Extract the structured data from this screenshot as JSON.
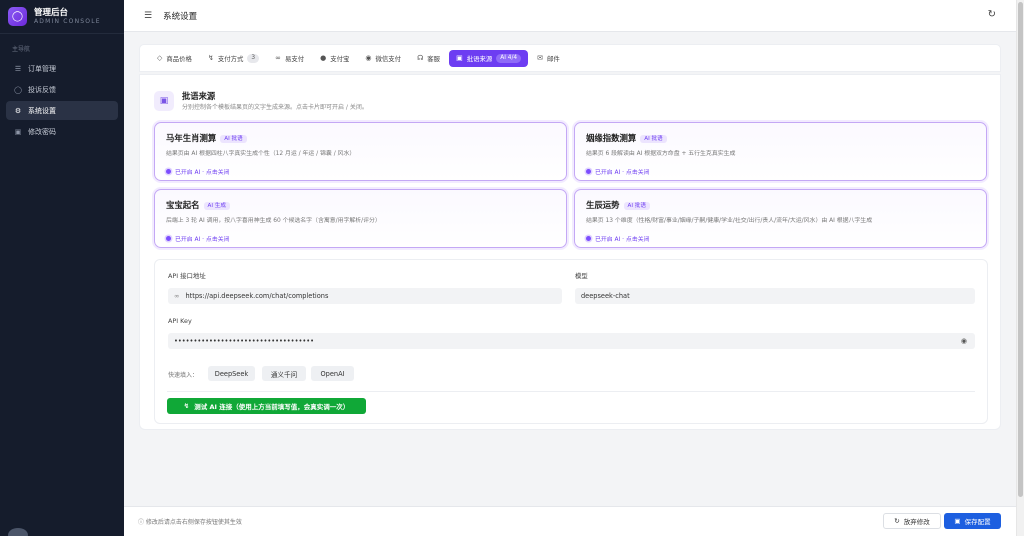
{
  "app": {
    "title": "管理后台",
    "subtitle": "ADMIN CONSOLE",
    "logo_icon": "lightbulb-icon"
  },
  "sidebar": {
    "section": "主导航",
    "items": [
      {
        "label": "订单管理",
        "icon": "list-icon",
        "active": false
      },
      {
        "label": "投诉反馈",
        "icon": "chat-bubble-icon",
        "active": false
      },
      {
        "label": "系统设置",
        "icon": "gear-icon",
        "active": true
      },
      {
        "label": "修改密码",
        "icon": "lock-icon",
        "active": false
      }
    ]
  },
  "header": {
    "title": "系统设置"
  },
  "tabs": [
    {
      "label": "商品价格",
      "icon": "tag-icon"
    },
    {
      "label": "支付方式",
      "icon": "lightning-icon",
      "badge": "3"
    },
    {
      "label": "易支付",
      "icon": "link-icon"
    },
    {
      "label": "支付宝",
      "icon": "alipay-icon"
    },
    {
      "label": "微信支付",
      "icon": "wechat-icon"
    },
    {
      "label": "客服",
      "icon": "headset-icon"
    },
    {
      "label": "批语来源",
      "icon": "robot-icon",
      "badge": "AI 4/4",
      "active": true
    },
    {
      "label": "邮件",
      "icon": "mail-icon"
    }
  ],
  "section": {
    "title": "批语来源",
    "description": "分别控制各个模板结果页的文字生成来源。点击卡片即可开启 / 关闭。"
  },
  "cards": [
    {
      "title": "马年生肖测算",
      "tag": "AI 批语",
      "desc": "结果页由 AI 根据四柱八字真实生成个性（12 月运 / 年运 / 锦囊 / 风水）",
      "status": "已开启 AI · 点击关闭"
    },
    {
      "title": "姻缘指数测算",
      "tag": "AI 批语",
      "desc": "结果页 6 段解读由 AI 根据双方命盘 + 五行生克真实生成",
      "status": "已开启 AI · 点击关闭"
    },
    {
      "title": "宝宝起名",
      "tag": "AI 生成",
      "desc": "后端上 3 轮 AI 调用，按八字喜用神生成 60 个候选名字（含寓意/用字解析/评分）",
      "status": "已开启 AI · 点击关闭"
    },
    {
      "title": "生辰运势",
      "tag": "AI 批语",
      "desc": "结果页 13 个维度（性格/财富/事业/姻缘/子嗣/健康/学业/社交/出行/贵人/流年/大运/风水）由 AI 根据八字生成",
      "status": "已开启 AI · 点击关闭"
    }
  ],
  "api": {
    "endpoint_label": "API 接口地址",
    "endpoint_value": "https://api.deepseek.com/chat/completions",
    "model_label": "模型",
    "model_value": "deepseek-chat",
    "key_label": "API Key",
    "key_value": "••••••••••••••••••••••••••••••••••••"
  },
  "quick_fill": {
    "label": "快速填入：",
    "options": [
      "DeepSeek",
      "通义千问",
      "OpenAI"
    ]
  },
  "test_button": "测试 AI 连接（使用上方当前填写值，会真实调一次）",
  "footer": {
    "hint": "修改后请点击右侧保存按钮使其生效",
    "discard": "放弃修改",
    "save": "保存配置"
  },
  "colors": {
    "accent": "#6d3df2",
    "sidebar_bg": "#151c2c",
    "success": "#10a837",
    "primary": "#1d5fe0"
  }
}
